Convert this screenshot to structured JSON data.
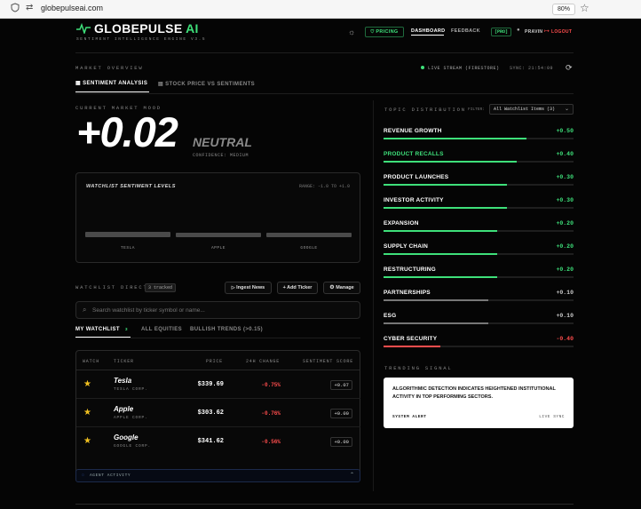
{
  "browser": {
    "url": "globepulseai.com",
    "zoom": "80%"
  },
  "header": {
    "logo_main": "GLOBEPULSE",
    "logo_ai": "AI",
    "tagline": "SENTIMENT INTELLIGENCE ENGINE V3.5",
    "pricing": "PRICING",
    "dashboard": "DASHBOARD",
    "feedback": "FEEDBACK",
    "badge": "[PRO]",
    "user": "PRAVIN",
    "logout": "LOGOUT"
  },
  "overview": {
    "label": "MARKET OVERVIEW",
    "live": "LIVE STREAM (FIRESTORE)",
    "sync": "SYNC: 21:54:09"
  },
  "tabs": {
    "sentiment": "SENTIMENT ANALYSIS",
    "stock": "STOCK PRICE VS SENTIMENTS"
  },
  "mood": {
    "label": "CURRENT MARKET MOOD",
    "value": "+0.02",
    "word": "NEUTRAL",
    "confidence": "CONFIDENCE: MEDIUM"
  },
  "levels": {
    "title": "WATCHLIST SENTIMENT LEVELS",
    "range": "RANGE: -1.0 TO +1.0",
    "bars": [
      {
        "label": "TESLA",
        "value": 0.07
      },
      {
        "label": "APPLE",
        "value": 0.0
      },
      {
        "label": "GOOGLE",
        "value": 0.0
      }
    ]
  },
  "directory": {
    "label": "WATCHLIST DIRECTORY",
    "tracked": "3 tracked",
    "ingest": "Ingest News",
    "add": "+ Add Ticker",
    "manage": "Manage",
    "search_placeholder": "Search watchlist by ticker symbol or name...",
    "tabs": {
      "mine": "MY WATCHLIST",
      "mine_count": "3",
      "all": "ALL EQUITIES",
      "bullish": "BULLISH TRENDS (>0.15)"
    }
  },
  "table": {
    "headers": {
      "watch": "WATCH",
      "ticker": "TICKER",
      "price": "PRICE",
      "change": "24H CHANGE",
      "score": "SENTIMENT SCORE"
    },
    "rows": [
      {
        "name": "Tesla",
        "corp": "TESLA CORP.",
        "price": "$339.69",
        "change": "-0.75%",
        "score": "+0.07"
      },
      {
        "name": "Apple",
        "corp": "APPLE CORP.",
        "price": "$303.62",
        "change": "-0.76%",
        "score": "+0.00"
      },
      {
        "name": "Google",
        "corp": "GOOGLE CORP.",
        "price": "$341.62",
        "change": "-0.56%",
        "score": "+0.00"
      }
    ]
  },
  "agent": {
    "label": "AGENT ACTIVITY"
  },
  "topics": {
    "label": "TOPIC DISTRIBUTION",
    "filter_label": "FILTER:",
    "filter_value": "All Watchlist Items (3)",
    "items": [
      {
        "name": "REVENUE GROWTH",
        "value": "+0.50",
        "fill": 0.75,
        "color": "#3ee07a"
      },
      {
        "name": "PRODUCT RECALLS",
        "value": "+0.40",
        "fill": 0.7,
        "color": "#3ee07a",
        "highlight": true
      },
      {
        "name": "PRODUCT LAUNCHES",
        "value": "+0.30",
        "fill": 0.65,
        "color": "#3ee07a"
      },
      {
        "name": "INVESTOR ACTIVITY",
        "value": "+0.30",
        "fill": 0.65,
        "color": "#3ee07a"
      },
      {
        "name": "EXPANSION",
        "value": "+0.20",
        "fill": 0.6,
        "color": "#3ee07a"
      },
      {
        "name": "SUPPLY CHAIN",
        "value": "+0.20",
        "fill": 0.6,
        "color": "#3ee07a"
      },
      {
        "name": "RESTRUCTURING",
        "value": "+0.20",
        "fill": 0.6,
        "color": "#3ee07a"
      },
      {
        "name": "PARTNERSHIPS",
        "value": "+0.10",
        "fill": 0.55,
        "color": "#777777"
      },
      {
        "name": "ESG",
        "value": "+0.10",
        "fill": 0.55,
        "color": "#777777"
      },
      {
        "name": "CYBER SECURITY",
        "value": "-0.40",
        "fill": 0.3,
        "color": "#ff4d4d"
      }
    ]
  },
  "trending": {
    "label": "TRENDING SIGNAL",
    "text": "ALGORITHMIC DETECTION INDICATES HEIGHTENED INSTITUTIONAL ACTIVITY IN TOP PERFORMING SECTORS.",
    "alert": "SYSTEM ALERT",
    "sync": "LIVE SYNC"
  }
}
